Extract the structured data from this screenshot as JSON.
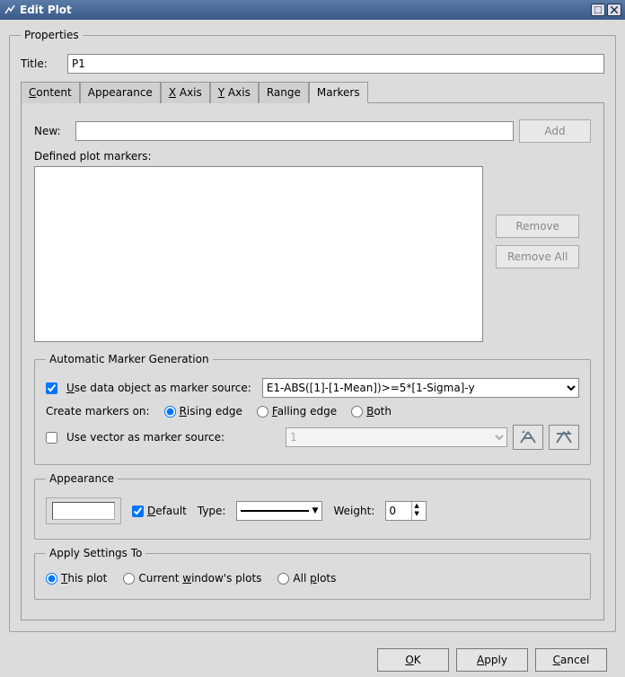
{
  "window": {
    "title": "Edit Plot"
  },
  "properties": {
    "legend": "Properties",
    "titleLabel": "Title:",
    "titleValue": "P1"
  },
  "tabs": {
    "items": [
      "Content",
      "Appearance",
      "X Axis",
      "Y Axis",
      "Range",
      "Markers"
    ],
    "underlines": [
      "C",
      "",
      "X",
      "Y",
      "",
      ""
    ],
    "activeIndex": 5
  },
  "markers": {
    "newLabel": "New:",
    "newValue": "",
    "addLabel": "Add",
    "definedLabel": "Defined plot markers:",
    "removeLabel": "Remove",
    "removeAllLabel": "Remove All"
  },
  "autoGen": {
    "legend": "Automatic Marker Generation",
    "useDataLabel": "Use data object as marker source:",
    "useDataChecked": true,
    "dataSource": "E1-ABS([1]-[1-Mean])>=5*[1-Sigma]-y",
    "createOnLabel": "Create markers on:",
    "options": {
      "rising": {
        "label": "Rising edge",
        "checked": true
      },
      "falling": {
        "label": "Falling edge",
        "checked": false
      },
      "both": {
        "label": "Both",
        "checked": false
      }
    },
    "useVectorLabel": "Use vector as marker source:",
    "useVectorChecked": false,
    "vectorValue": "1"
  },
  "appearance": {
    "legend": "Appearance",
    "defaultLabel": "Default",
    "defaultChecked": true,
    "typeLabel": "Type:",
    "weightLabel": "Weight:",
    "weightValue": "0"
  },
  "applyTo": {
    "legend": "Apply Settings To",
    "options": {
      "thisPlot": {
        "label": "This plot",
        "checked": true
      },
      "windowPlots": {
        "label": "Current window's plots",
        "checked": false
      },
      "allPlots": {
        "label": "All plots",
        "checked": false
      }
    }
  },
  "buttons": {
    "ok": "OK",
    "apply": "Apply",
    "cancel": "Cancel"
  }
}
